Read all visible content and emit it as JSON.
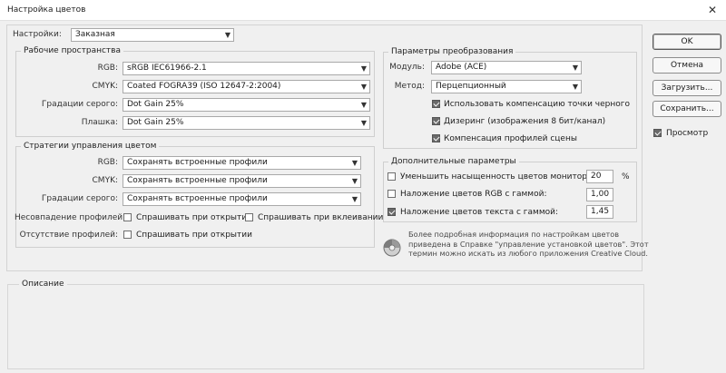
{
  "window": {
    "title": "Настройка цветов",
    "close_glyph": "✕"
  },
  "settings": {
    "label": "Настройки:",
    "value": "Заказная"
  },
  "working_spaces": {
    "title": "Рабочие пространства",
    "rows": [
      {
        "label": "RGB:",
        "value": "sRGB IEC61966-2.1"
      },
      {
        "label": "CMYK:",
        "value": "Coated FOGRA39 (ISO 12647-2:2004)"
      },
      {
        "label": "Градации серого:",
        "value": "Dot Gain 25%"
      },
      {
        "label": "Плашка:",
        "value": "Dot Gain 25%"
      }
    ]
  },
  "policies": {
    "title": "Стратегии управления цветом",
    "rows": [
      {
        "label": "RGB:",
        "value": "Сохранять встроенные профили"
      },
      {
        "label": "CMYK:",
        "value": "Сохранять встроенные профили"
      },
      {
        "label": "Градации серого:",
        "value": "Сохранять встроенные профили"
      }
    ],
    "mismatch": {
      "label": "Несовпадение профилей:",
      "ask_open": "Спрашивать при открытии",
      "ask_paste": "Спрашивать при вклеивании",
      "ask_open_checked": false,
      "ask_paste_checked": false
    },
    "missing": {
      "label": "Отсутствие профилей:",
      "ask_open": "Спрашивать при открытии",
      "ask_open_checked": false
    }
  },
  "conversion": {
    "title": "Параметры преобразования",
    "engine": {
      "label": "Модуль:",
      "value": "Adobe (ACE)"
    },
    "intent": {
      "label": "Метод:",
      "value": "Перцепционный"
    },
    "options": [
      {
        "label": "Использовать компенсацию точки черного",
        "checked": true
      },
      {
        "label": "Дизеринг (изображения 8 бит/канал)",
        "checked": true
      },
      {
        "label": "Компенсация профилей сцены",
        "checked": true
      }
    ]
  },
  "advanced": {
    "title": "Дополнительные параметры",
    "rows": [
      {
        "label": "Уменьшить насыщенность цветов монитора на:",
        "value": "20",
        "unit": "%",
        "checked": false
      },
      {
        "label": "Наложение цветов RGB с гаммой:",
        "value": "1,00",
        "checked": false
      },
      {
        "label": "Наложение цветов текста с гаммой:",
        "value": "1,45",
        "checked": true
      }
    ]
  },
  "info_text": [
    "Более подробная информация по настройкам цветов",
    "приведена в Справке \"управление установкой цветов\". Этот",
    "термин можно искать из любого приложения Creative Cloud."
  ],
  "description": {
    "title": "Описание"
  },
  "buttons": {
    "ok": "OK",
    "cancel": "Отмена",
    "load": "Загрузить...",
    "save": "Сохранить..."
  },
  "preview": {
    "label": "Просмотр",
    "checked": true
  },
  "icons": {
    "dropdown": "chevron-down-icon",
    "info": "color-wheel-icon"
  }
}
